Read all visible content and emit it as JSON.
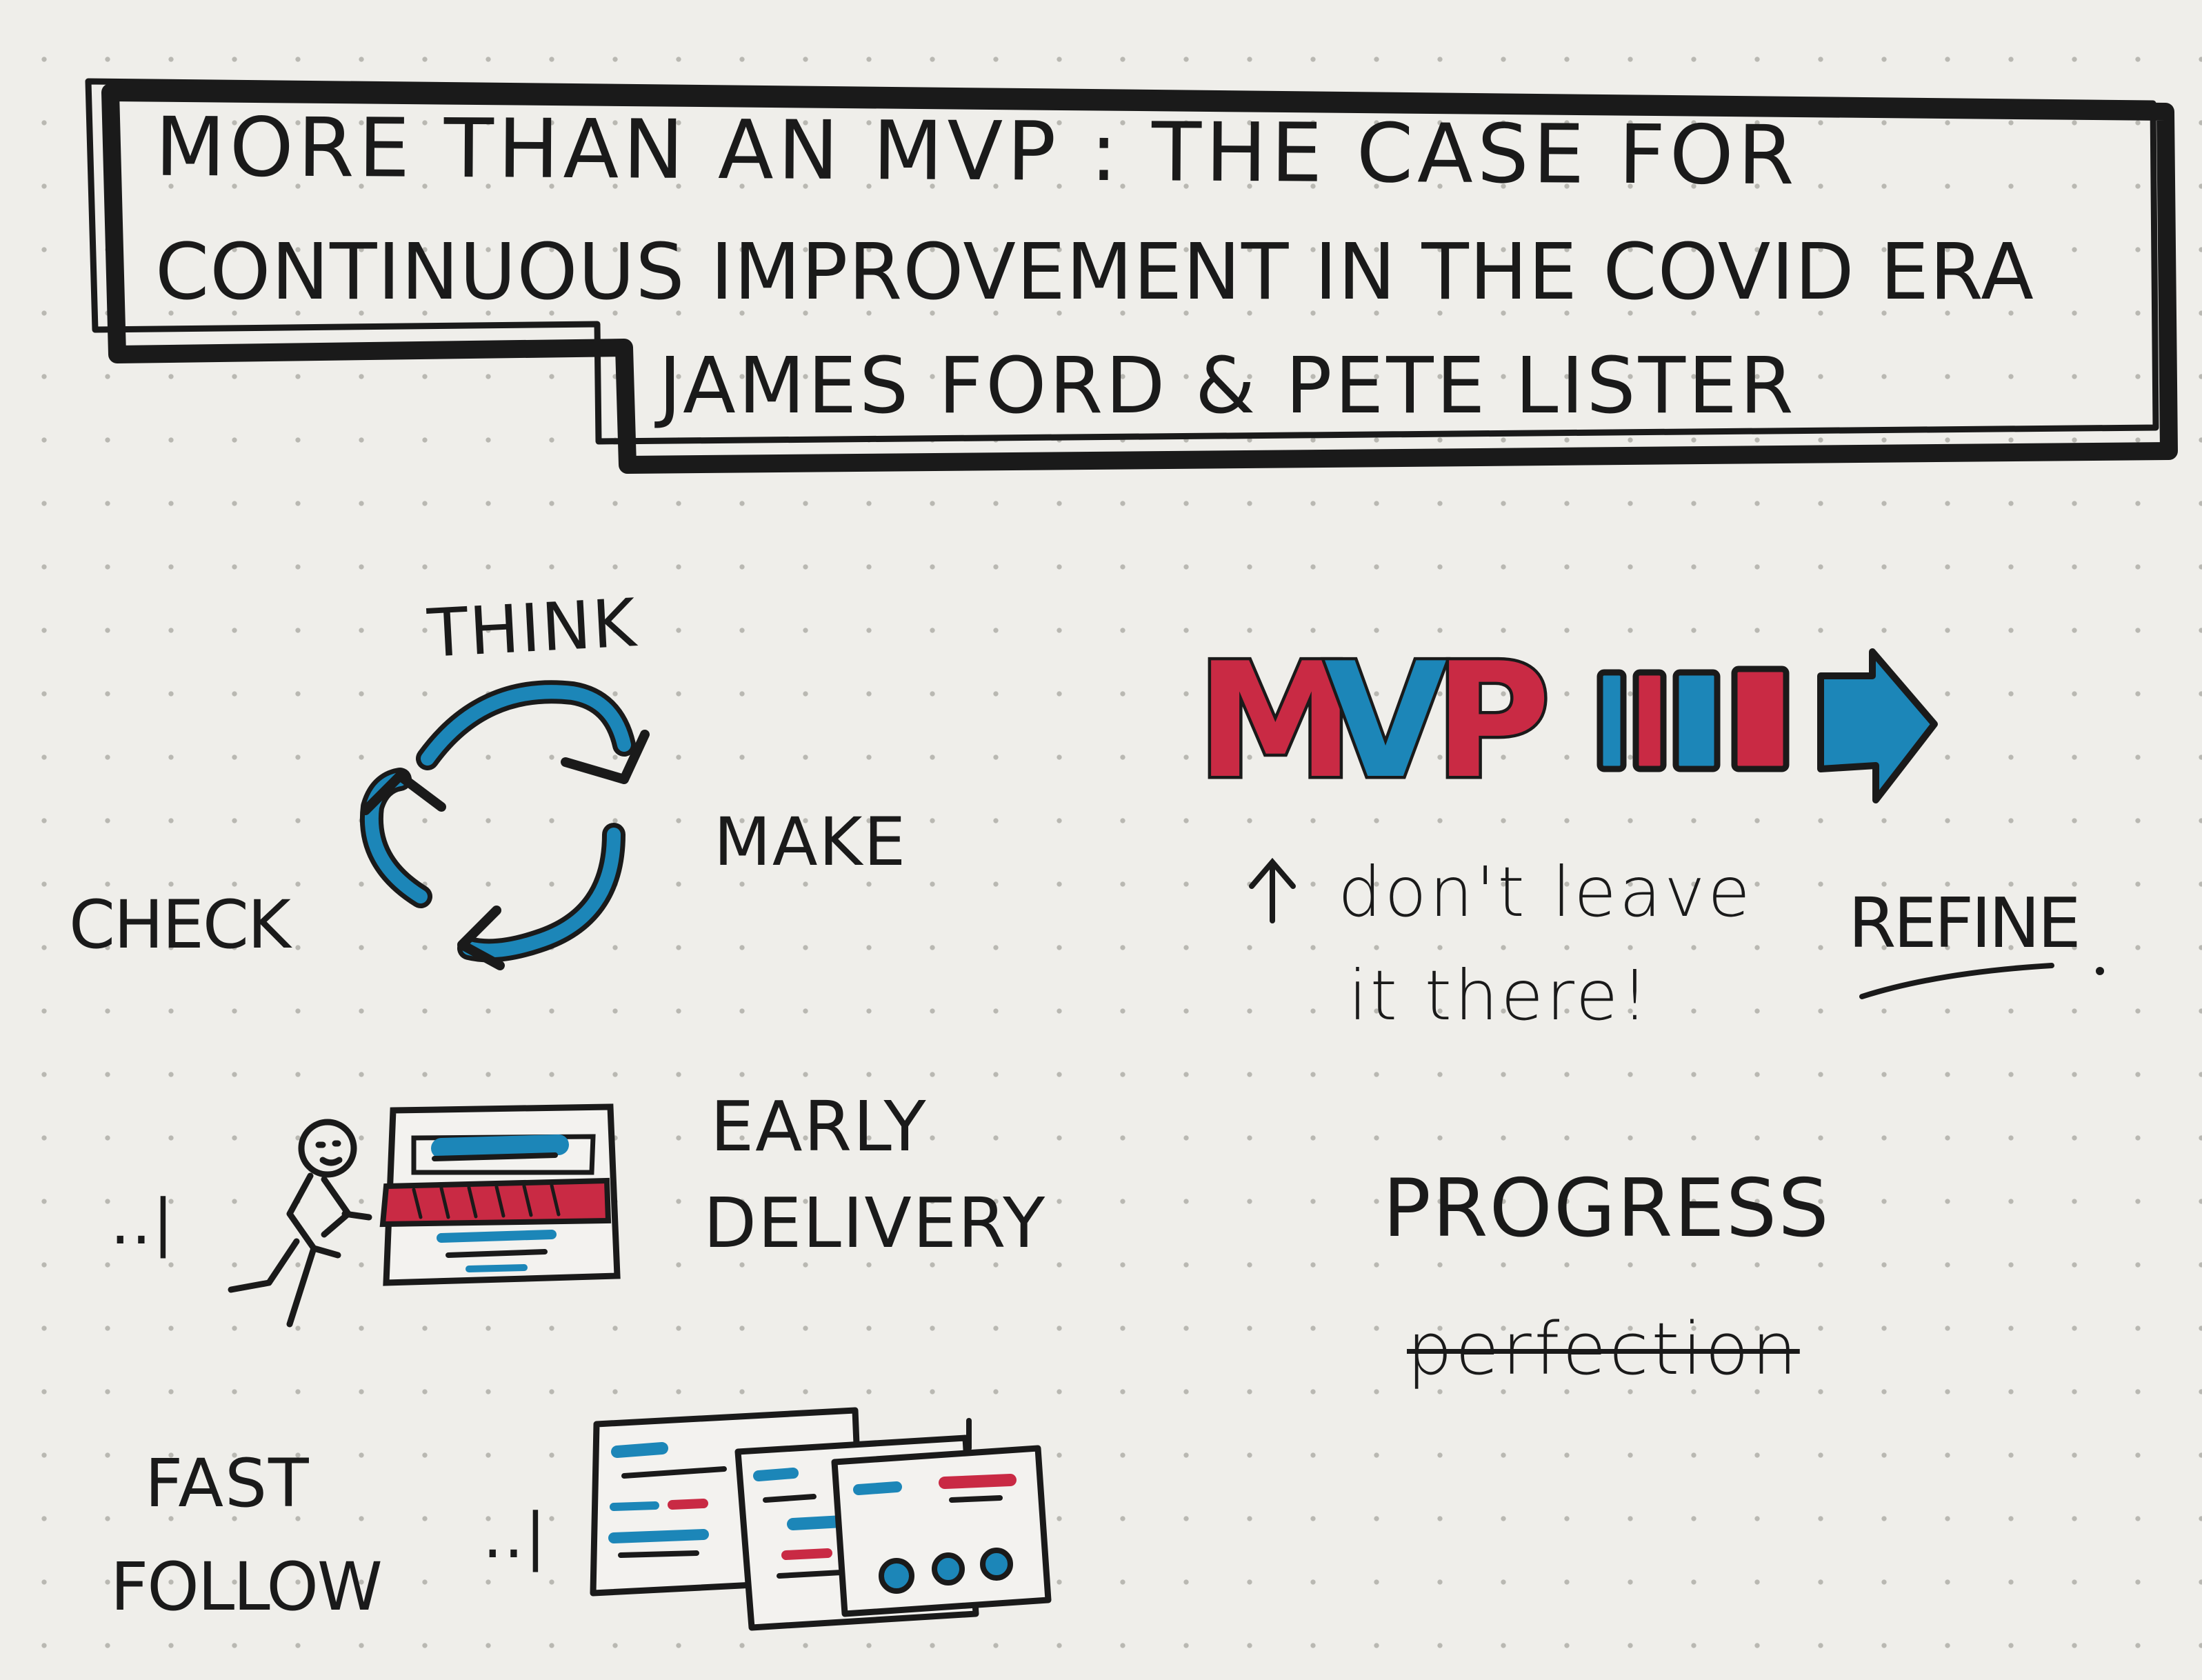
{
  "title": {
    "line1": "MORE THAN AN MVP : THE CASE FOR",
    "line2": "CONTINUOUS IMPROVEMENT IN THE COVID ERA",
    "authors": "JAMES FORD & PETE LISTER"
  },
  "cycle": {
    "think": "THINK",
    "make": "MAKE",
    "check": "CHECK"
  },
  "mvp": {
    "letters": [
      "M",
      "V",
      "P"
    ],
    "note_line1": "don't leave",
    "note_line2": "it there!",
    "refine": "REFINE"
  },
  "early_delivery": {
    "line1": "EARLY",
    "line2": "DELIVERY",
    "dots": "..|"
  },
  "progress": {
    "label": "PROGRESS",
    "struck": "perfection"
  },
  "fast_follow": {
    "line1": "FAST",
    "line2": "FOLLOW",
    "dots": "..|"
  },
  "colors": {
    "ink": "#1a1a1a",
    "red": "#c92a44",
    "blue": "#1c86b8",
    "paper": "#efeeea"
  }
}
